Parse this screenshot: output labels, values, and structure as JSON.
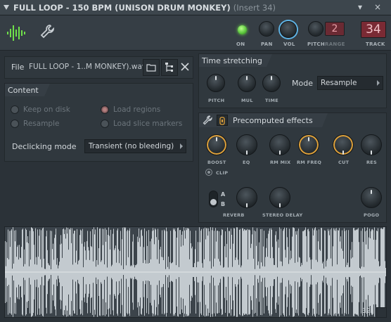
{
  "window": {
    "title": "FULL LOOP - 150 BPM (UNISON DRUM MONKEY)",
    "insert": "(Insert 34)",
    "close_glyph": "×",
    "collapse_glyph": "▾"
  },
  "toolbar": {
    "icons": [
      "waveform-icon",
      "wrench-icon"
    ],
    "labels": {
      "on": "ON",
      "pan": "PAN",
      "vol": "VOL",
      "pitch": "PITCH",
      "range": "RANGE",
      "track": "TRACK"
    },
    "range_value": "2",
    "track_value": "34",
    "accent": "#57c23a"
  },
  "file": {
    "label": "File",
    "name": "FULL LOOP - 1..M MONKEY).wav"
  },
  "content": {
    "title": "Content",
    "options": {
      "keep_on_disk": "Keep on disk",
      "load_regions": "Load regions",
      "resample": "Resample",
      "load_slice_markers": "Load slice markers"
    },
    "declicking_label": "Declicking mode",
    "declicking_value": "Transient (no bleeding)"
  },
  "time_stretching": {
    "title": "Time stretching",
    "knobs": {
      "pitch": "PITCH",
      "mul": "MUL",
      "time": "TIME"
    },
    "mode_label": "Mode",
    "mode_value": "Resample"
  },
  "precomputed": {
    "title": "Precomputed effects",
    "knobs": {
      "boost": "BOOST",
      "eq": "EQ",
      "rm_mix": "RM MIX",
      "rm_freq": "RM FREQ",
      "cut": "CUT",
      "res": "RES",
      "reverb": "REVERB",
      "stereo_delay": "STEREO DELAY",
      "pogo": "POGO"
    },
    "clip_label": "CLIP",
    "a_label": "A",
    "b_label": "B",
    "knob_accent": "#e0a23a"
  },
  "waveform": {
    "beat_count": "32"
  }
}
